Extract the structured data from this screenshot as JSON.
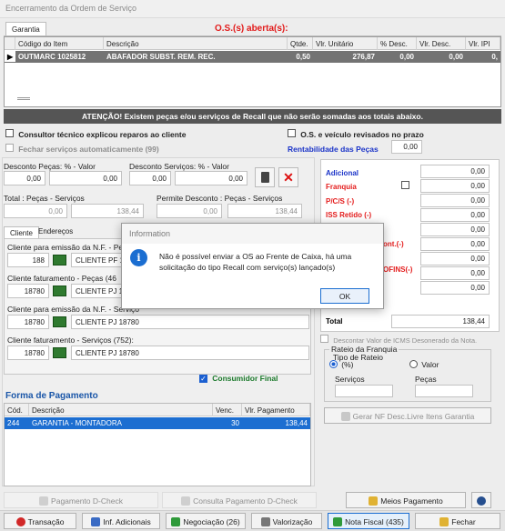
{
  "window": {
    "title": "Encerramento da Ordem de Serviço"
  },
  "tab": {
    "label": "Garantia"
  },
  "os_status": "O.S.(s) aberta(s):",
  "items": {
    "columns": [
      "Código do Item",
      "Descrição",
      "Qtde.",
      "Vlr. Unitário",
      "% Desc.",
      "Vlr. Desc.",
      "Vlr. IPI"
    ],
    "rows": [
      [
        "OUTMARC 1025812",
        "ABAFADOR SUBST. REM. REC.",
        "0,50",
        "276,87",
        "0,00",
        "0,00",
        "0,"
      ]
    ]
  },
  "warning": "ATENÇÃO! Existem peças e/ou serviços de Recall que não serão somadas aos totais abaixo.",
  "options": {
    "consultor": "Consultor técnico explicou reparos ao cliente",
    "os_veiculo": "O.S. e veículo revisados no prazo",
    "fechar_servicos": "Fechar serviços automaticamente (99)",
    "rentabilidade_label": "Rentabilidade das Peças",
    "rentabilidade_value": "0,00"
  },
  "desconto": {
    "pecas_label": "Desconto Peças: % - Valor",
    "pecas_pct": "0,00",
    "pecas_valor": "0,00",
    "servicos_label": "Desconto Serviços: % - Valor",
    "servicos_pct": "0,00",
    "servicos_valor": "0,00"
  },
  "totais": {
    "label": "Total : Peças - Serviços",
    "pecas": "0,00",
    "servicos": "138,44",
    "permite_label": "Permite Desconto : Peças - Serviços",
    "permite_pecas": "0,00",
    "permite_servicos": "138,44"
  },
  "summary": {
    "adicional": {
      "label": "Adicional",
      "value": "0,00"
    },
    "franquia": {
      "label": "Franquia",
      "value": "0,00"
    },
    "pcs": {
      "label": "P/C/S (-)",
      "value": "0,00"
    },
    "iss": {
      "label": "ISS Retido (-)",
      "value": "0,00"
    },
    "v5": "0,00",
    "cont_label": "ont.(-)",
    "v6": "0,00",
    "cofins_label": "OFINS(-)",
    "v7": "0,00",
    "v8": "0,00",
    "v9": "0,00",
    "total": {
      "label": "Total",
      "value": "138,44"
    }
  },
  "client_tabs": [
    "Cliente",
    "Endereços"
  ],
  "clients": [
    {
      "label": "Cliente para emissão da N.F. - Peças (1",
      "code": "188",
      "name": "CLIENTE PF 1"
    },
    {
      "label": "Cliente faturamento - Peças (46",
      "code": "18780",
      "name": "CLIENTE PJ 1"
    },
    {
      "label": "Cliente para emissão da N.F. - Serviço",
      "code": "18780",
      "name": "CLIENTE PJ 18780"
    },
    {
      "label": "Cliente faturamento - Serviços (752):",
      "code": "18780",
      "name": "CLIENTE PJ 18780"
    }
  ],
  "consumidor_final": "Consumidor Final",
  "icms_label": "Descontar Valor de ICMS Desonerado da Nota.",
  "rateio": {
    "title": "Rateio da Franquia",
    "tipo_label": "Tipo de Rateio",
    "pct_label": "(%)",
    "valor_label": "Valor",
    "servicos_label": "Serviços",
    "pecas_label": "Peças"
  },
  "payment": {
    "title": "Forma de Pagamento",
    "columns": [
      "Cód.",
      "Descrição",
      "Venc.",
      "Vlr. Pagamento"
    ],
    "rows": [
      [
        "244",
        "GARANTIA - MONTADORA",
        "30",
        "138,44"
      ]
    ]
  },
  "gerar_nf": "Gerar NF Desc.Livre Itens Garantia",
  "midbuttons": {
    "pagamento": "Pagamento D-Check",
    "consulta": "Consulta Pagamento D-Check",
    "meios": "Meios Pagamento"
  },
  "bottom": {
    "transacao": "Transação",
    "inf": "Inf. Adicionais",
    "negociacao": "Negociação (26)",
    "valorizacao": "Valorização",
    "nota": "Nota Fiscal (435)",
    "fechar": "Fechar"
  },
  "dialog": {
    "title": "Information",
    "message": "Não é possível enviar a OS ao Frente de Caixa, há uma solicitação do tipo Recall com serviço(s) lançado(s)",
    "ok": "OK"
  },
  "colors": {
    "red": "#e21b1b",
    "blue": "#1a56a8",
    "selection": "#1c6ed1"
  }
}
